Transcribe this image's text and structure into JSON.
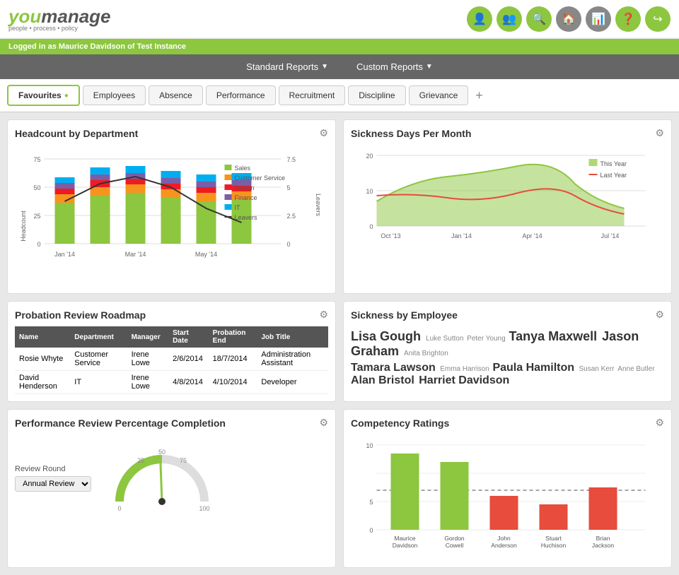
{
  "header": {
    "logo_you": "you",
    "logo_manage": "manage",
    "logo_sub": "people • process • policy",
    "login_text": "Logged in as Maurice Davidson of Test Instance"
  },
  "nav": {
    "items": [
      {
        "label": "Standard Reports",
        "id": "standard-reports"
      },
      {
        "label": "Custom Reports",
        "id": "custom-reports"
      }
    ]
  },
  "tabs": {
    "items": [
      {
        "label": "Favourites",
        "id": "favourites",
        "active": true,
        "fav": true
      },
      {
        "label": "Employees",
        "id": "employees"
      },
      {
        "label": "Absence",
        "id": "absence"
      },
      {
        "label": "Performance",
        "id": "performance"
      },
      {
        "label": "Recruitment",
        "id": "recruitment"
      },
      {
        "label": "Discipline",
        "id": "discipline"
      },
      {
        "label": "Grievance",
        "id": "grievance"
      }
    ]
  },
  "headcount_widget": {
    "title": "Headcount by Department",
    "y_labels": [
      "75",
      "50",
      "25",
      "0"
    ],
    "y2_labels": [
      "7.5",
      "5",
      "2.5",
      "0"
    ],
    "x_labels": [
      "Jan '14",
      "Mar '14",
      "May '14"
    ],
    "legend": [
      {
        "label": "Sales",
        "color": "#8dc63f"
      },
      {
        "label": "Customer Service",
        "color": "#f7941d"
      },
      {
        "label": "Design",
        "color": "#ed1c24"
      },
      {
        "label": "Finance",
        "color": "#7b5ea7"
      },
      {
        "label": "IT",
        "color": "#00aeef"
      },
      {
        "label": "Leavers",
        "color": "#333",
        "line": true
      }
    ]
  },
  "sickness_widget": {
    "title": "Sickness Days Per Month",
    "y_labels": [
      "20",
      "10",
      "0"
    ],
    "x_labels": [
      "Oct '13",
      "Jan '14",
      "Apr '14",
      "Jul '14"
    ],
    "legend": [
      {
        "label": "This Year",
        "color": "#8dc63f"
      },
      {
        "label": "Last Year",
        "color": "#e74c3c",
        "line": true
      }
    ]
  },
  "probation_widget": {
    "title": "Probation Review Roadmap",
    "columns": [
      "Name",
      "Department",
      "Manager",
      "Start Date",
      "Probation End",
      "Job Title"
    ],
    "rows": [
      [
        "Rosie Whyte",
        "Customer Service",
        "Irene Lowe",
        "2/6/2014",
        "18/7/2014",
        "Administration Assistant"
      ],
      [
        "David Henderson",
        "IT",
        "Irene Lowe",
        "4/8/2014",
        "4/10/2014",
        "Developer"
      ]
    ]
  },
  "performance_widget": {
    "title": "Performance Review Percentage Completion",
    "review_label": "Review Round",
    "select_label": "Annual Review",
    "gauge_value": 50
  },
  "sickness_employee_widget": {
    "title": "Sickness by Employee",
    "row1": [
      {
        "name": "Lisa Gough",
        "size": "big"
      },
      {
        "name": "Luke Sutton",
        "size": "small"
      },
      {
        "name": "Peter Young",
        "size": "small"
      },
      {
        "name": "Tanya Maxwell",
        "size": "big"
      },
      {
        "name": "Jason Graham",
        "size": "big"
      },
      {
        "name": "Anita Brighton",
        "size": "small"
      }
    ],
    "row2": [
      {
        "name": "Tamara Lawson",
        "size": "big"
      },
      {
        "name": "Emma Harrison",
        "size": "small"
      },
      {
        "name": "Paula Hamilton",
        "size": "big"
      },
      {
        "name": "Susan Kerr",
        "size": "small"
      },
      {
        "name": "Anne Butler",
        "size": "small"
      },
      {
        "name": "Alan Bristol",
        "size": "big"
      },
      {
        "name": "Harriet Davidson",
        "size": "big"
      }
    ]
  },
  "competency_widget": {
    "title": "Competency Ratings",
    "y_max": 10,
    "target_line": 6,
    "bars": [
      {
        "label": "Maurice\nDavidson",
        "value": 9,
        "color": "#8dc63f"
      },
      {
        "label": "Gordon\nCowell",
        "value": 8,
        "color": "#8dc63f"
      },
      {
        "label": "John\nAnderson",
        "value": 4,
        "color": "#e74c3c"
      },
      {
        "label": "Stuart\nHuchison",
        "value": 3,
        "color": "#e74c3c"
      },
      {
        "label": "Brian\nJackson",
        "value": 5,
        "color": "#e74c3c"
      }
    ]
  }
}
